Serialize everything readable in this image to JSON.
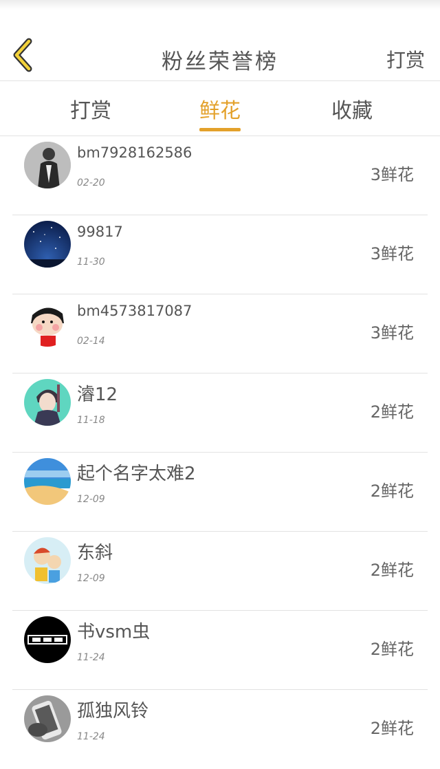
{
  "header": {
    "title": "粉丝荣誉榜",
    "right_action": "打赏"
  },
  "tabs": [
    {
      "label": "打赏",
      "active": false
    },
    {
      "label": "鲜花",
      "active": true
    },
    {
      "label": "收藏",
      "active": false
    }
  ],
  "accent_color": "#e3a12b",
  "fans": [
    {
      "name": "bm7928162586",
      "date": "02-20",
      "count": "3鲜花",
      "avatar": "man-in-suit-photo"
    },
    {
      "name": "99817",
      "date": "11-30",
      "count": "3鲜花",
      "avatar": "night-sky-photo"
    },
    {
      "name": "bm4573817087",
      "date": "02-14",
      "count": "3鲜花",
      "avatar": "cartoon-boy"
    },
    {
      "name": "濬12",
      "date": "11-18",
      "count": "2鲜花",
      "avatar": "anime-boy"
    },
    {
      "name": "起个名字太难2",
      "date": "12-09",
      "count": "2鲜花",
      "avatar": "beach-photo"
    },
    {
      "name": "东斜",
      "date": "12-09",
      "count": "2鲜花",
      "avatar": "cartoon-kids"
    },
    {
      "name": "书vsm虫",
      "date": "11-24",
      "count": "2鲜花",
      "avatar": "text-logo-black"
    },
    {
      "name": "孤独风铃",
      "date": "11-24",
      "count": "2鲜花",
      "avatar": "phone-hand-photo"
    }
  ]
}
